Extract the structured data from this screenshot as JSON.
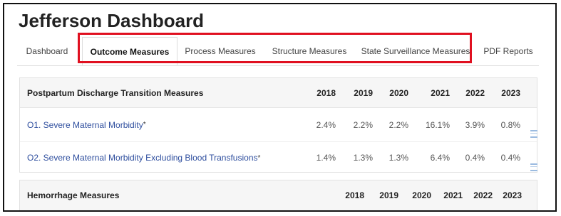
{
  "page_title": "Jefferson Dashboard",
  "tabs": [
    {
      "label": "Dashboard",
      "active": false
    },
    {
      "label": "Outcome Measures",
      "active": true
    },
    {
      "label": "Process Measures",
      "active": false
    },
    {
      "label": "Structure Measures",
      "active": false
    },
    {
      "label": "State Surveillance Measures",
      "active": false
    },
    {
      "label": "PDF Reports",
      "active": false
    }
  ],
  "highlight_color": "#e01020",
  "link_color": "#2e4e9e",
  "sections": [
    {
      "heading": "Postpartum Discharge Transition Measures",
      "years": [
        "2018",
        "2019",
        "2020",
        "2021",
        "2022",
        "2023"
      ],
      "rows": [
        {
          "label": "O1. Severe Maternal Morbidity",
          "marker": "*",
          "values": [
            "2.4%",
            "2.2%",
            "2.2%",
            "16.1%",
            "3.9%",
            "0.8%"
          ],
          "icon": "trend-chart-icon"
        },
        {
          "label": "O2. Severe Maternal Morbidity Excluding Blood Transfusions",
          "marker": "*",
          "values": [
            "1.4%",
            "1.3%",
            "1.3%",
            "6.4%",
            "0.4%",
            "0.4%"
          ],
          "icon": "trend-chart-icon"
        }
      ]
    },
    {
      "heading": "Hemorrhage Measures",
      "years": [
        "2018",
        "2019",
        "2020",
        "2021",
        "2022",
        "2023"
      ],
      "rows": []
    }
  ]
}
